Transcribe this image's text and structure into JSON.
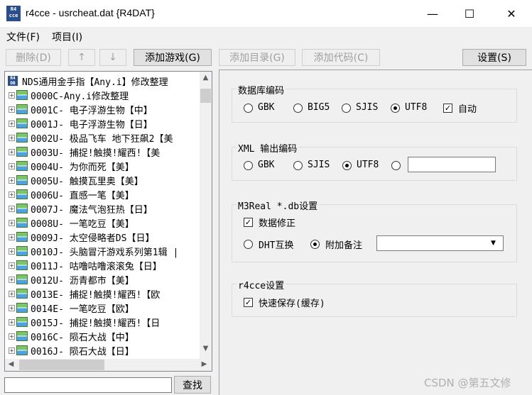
{
  "window": {
    "icon_text": "R4\ncce",
    "title": "r4cce - usrcheat.dat {R4DAT}",
    "minimize_glyph": "—",
    "maximize_glyph": "☐",
    "close_glyph": "✕"
  },
  "menu": {
    "file": "文件(F)",
    "project": "项目(I)"
  },
  "toolbar": {
    "delete": "删除(D)",
    "up": "↑",
    "down": "↓",
    "add_game": "添加游戏(G)",
    "add_folder": "添加目录(G)",
    "add_code": "添加代码(C)",
    "settings": "设置(S)"
  },
  "tree": {
    "root_icon": "R4\nDB",
    "root": "NDS通用金手指【Any.i】修改整理",
    "expander": "+",
    "items": [
      "0000C-Any.i修改整理",
      "0001C- 电子浮游生物【中】",
      "0001J- 电子浮游生物【日】",
      "0002U- 极品飞车 地下狂飙2【美",
      "0003U- 捕捉!触摸!耀西!【美",
      "0004U- 为你而死【美】",
      "0005U- 触摸瓦里奥【美】",
      "0006U- 直感一笔【美】",
      "0007J- 魔法气泡狂热【日】",
      "0008U- 一笔吃豆【美】",
      "0009J- 太空侵略者DS【日】",
      "0010J- 头脑冒汗游戏系列第1辑 |",
      "0011J- 咕噜咕噜滚滚兔【日】",
      "0012U- 沥青都市【美】",
      "0013E- 捕捉!触摸!耀西!【欧",
      "0014E- 一笔吃豆【欧】",
      "0015J- 捕捉!触摸!耀西!【日",
      "0016C- 陨石大战【中】",
      "0016J- 陨石大战【日】"
    ]
  },
  "search": {
    "value": "",
    "button": "查找"
  },
  "db_encoding": {
    "title": "数据库编码",
    "options": [
      "GBK",
      "BIG5",
      "SJIS",
      "UTF8"
    ],
    "selected": "UTF8",
    "auto_label": "自动",
    "auto_checked": true
  },
  "xml_encoding": {
    "title": "XML 输出编码",
    "options": [
      "GBK",
      "SJIS",
      "UTF8"
    ],
    "selected": "UTF8",
    "custom_value": ""
  },
  "m3real": {
    "title": "M3Real *.db设置",
    "fix_label": "数据修正",
    "fix_checked": true,
    "dht_label": "DHT互换",
    "note_label": "附加备注",
    "selected": "附加备注",
    "dropdown_value": ""
  },
  "r4cce": {
    "title": "r4cce设置",
    "quicksave_label": "快速保存(缓存)",
    "quicksave_checked": true
  },
  "watermark": "CSDN @第五文修",
  "check_glyph": "✓"
}
